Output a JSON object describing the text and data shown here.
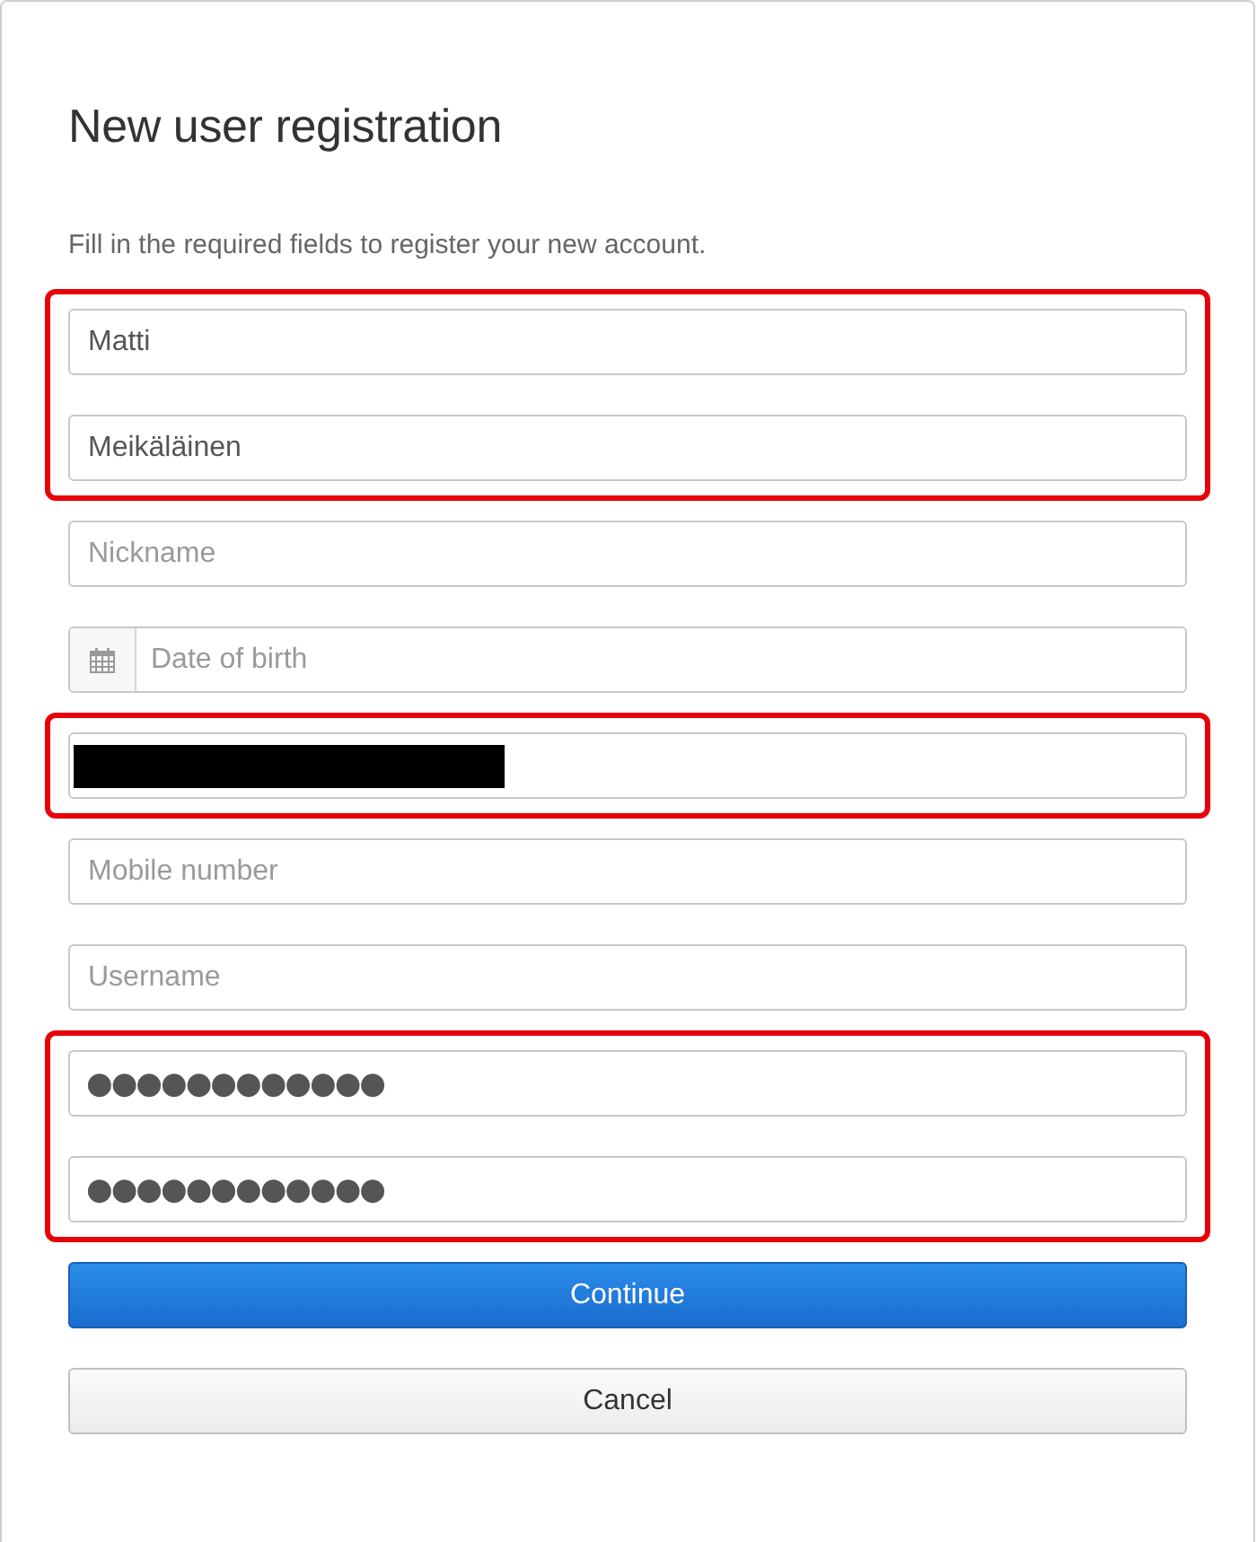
{
  "title": "New user registration",
  "subtitle": "Fill in the required fields to register your new account.",
  "field_groups": [
    {
      "highlighted": true,
      "fields": [
        {
          "kind": "text",
          "value": "Matti"
        },
        {
          "kind": "text",
          "value": "Meikäläinen"
        }
      ]
    },
    {
      "highlighted": false,
      "fields": [
        {
          "kind": "text",
          "placeholder": "Nickname"
        }
      ]
    },
    {
      "highlighted": false,
      "fields": [
        {
          "kind": "date",
          "placeholder": "Date of birth"
        }
      ]
    },
    {
      "highlighted": true,
      "fields": [
        {
          "kind": "redacted"
        }
      ]
    },
    {
      "highlighted": false,
      "fields": [
        {
          "kind": "text",
          "placeholder": "Mobile number"
        }
      ]
    },
    {
      "highlighted": false,
      "fields": [
        {
          "kind": "text",
          "placeholder": "Username"
        }
      ]
    },
    {
      "highlighted": true,
      "fields": [
        {
          "kind": "password",
          "value": "●●●●●●●●●●●●"
        },
        {
          "kind": "password",
          "value": "●●●●●●●●●●●●"
        }
      ]
    }
  ],
  "buttons": [
    {
      "kind": "primary",
      "label": "Continue"
    },
    {
      "kind": "secondary",
      "label": "Cancel"
    }
  ]
}
